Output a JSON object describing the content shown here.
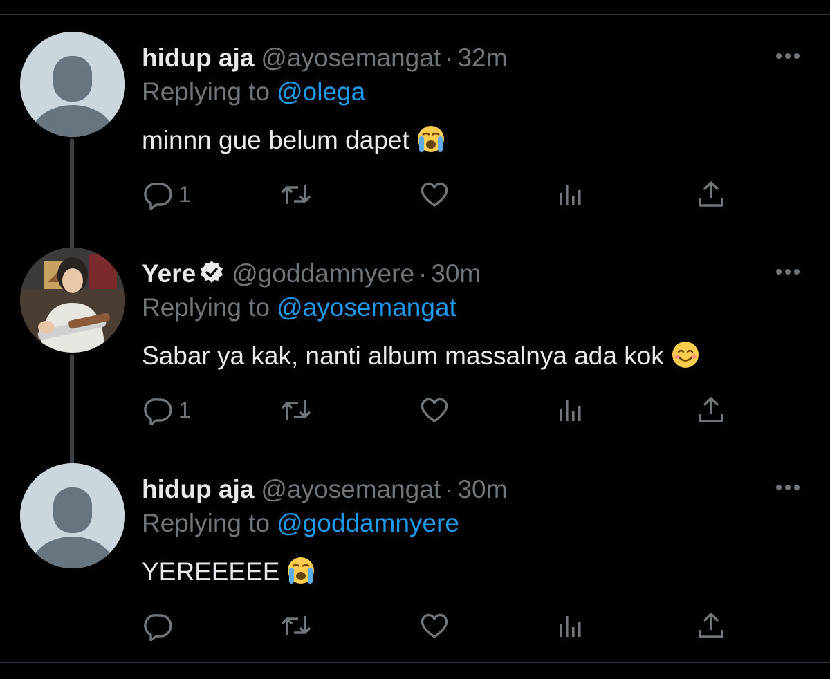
{
  "colors": {
    "background": "#000000",
    "text_primary": "#e7e9ea",
    "text_secondary": "#71767b",
    "accent": "#1d9bf0",
    "thread_line": "#3e4144"
  },
  "icons": {
    "reply": "reply-bubble-icon",
    "retweet": "retweet-icon",
    "like": "heart-icon",
    "views": "views-bar-chart-icon",
    "share": "share-upload-icon",
    "more": "more-dots-icon",
    "verified": "verified-badge-icon",
    "crying_emoji": "loudly-crying-face-emoji",
    "smiling_emoji": "smiling-face-emoji"
  },
  "tweets": [
    {
      "display_name": "hidup aja",
      "handle": "@ayosemangat",
      "separator": "·",
      "time": "32m",
      "replying_label": "Replying to",
      "replying_to": "@olega",
      "text": "minnn gue belum dapet",
      "emoji": "loudly-crying-face-emoji",
      "reply_count": "1",
      "verified": false,
      "avatar": "default-avatar"
    },
    {
      "display_name": "Yere",
      "handle": "@goddamnyere",
      "separator": "·",
      "time": "30m",
      "replying_label": "Replying to",
      "replying_to": "@ayosemangat",
      "text": "Sabar ya kak, nanti album massalnya ada kok",
      "emoji": "smiling-face-emoji",
      "reply_count": "1",
      "verified": true,
      "avatar": "photo-avatar"
    },
    {
      "display_name": "hidup aja",
      "handle": "@ayosemangat",
      "separator": "·",
      "time": "30m",
      "replying_label": "Replying to",
      "replying_to": "@goddamnyere",
      "text": "YEREEEEE",
      "emoji": "loudly-crying-face-emoji",
      "reply_count": "",
      "verified": false,
      "avatar": "default-avatar"
    }
  ]
}
